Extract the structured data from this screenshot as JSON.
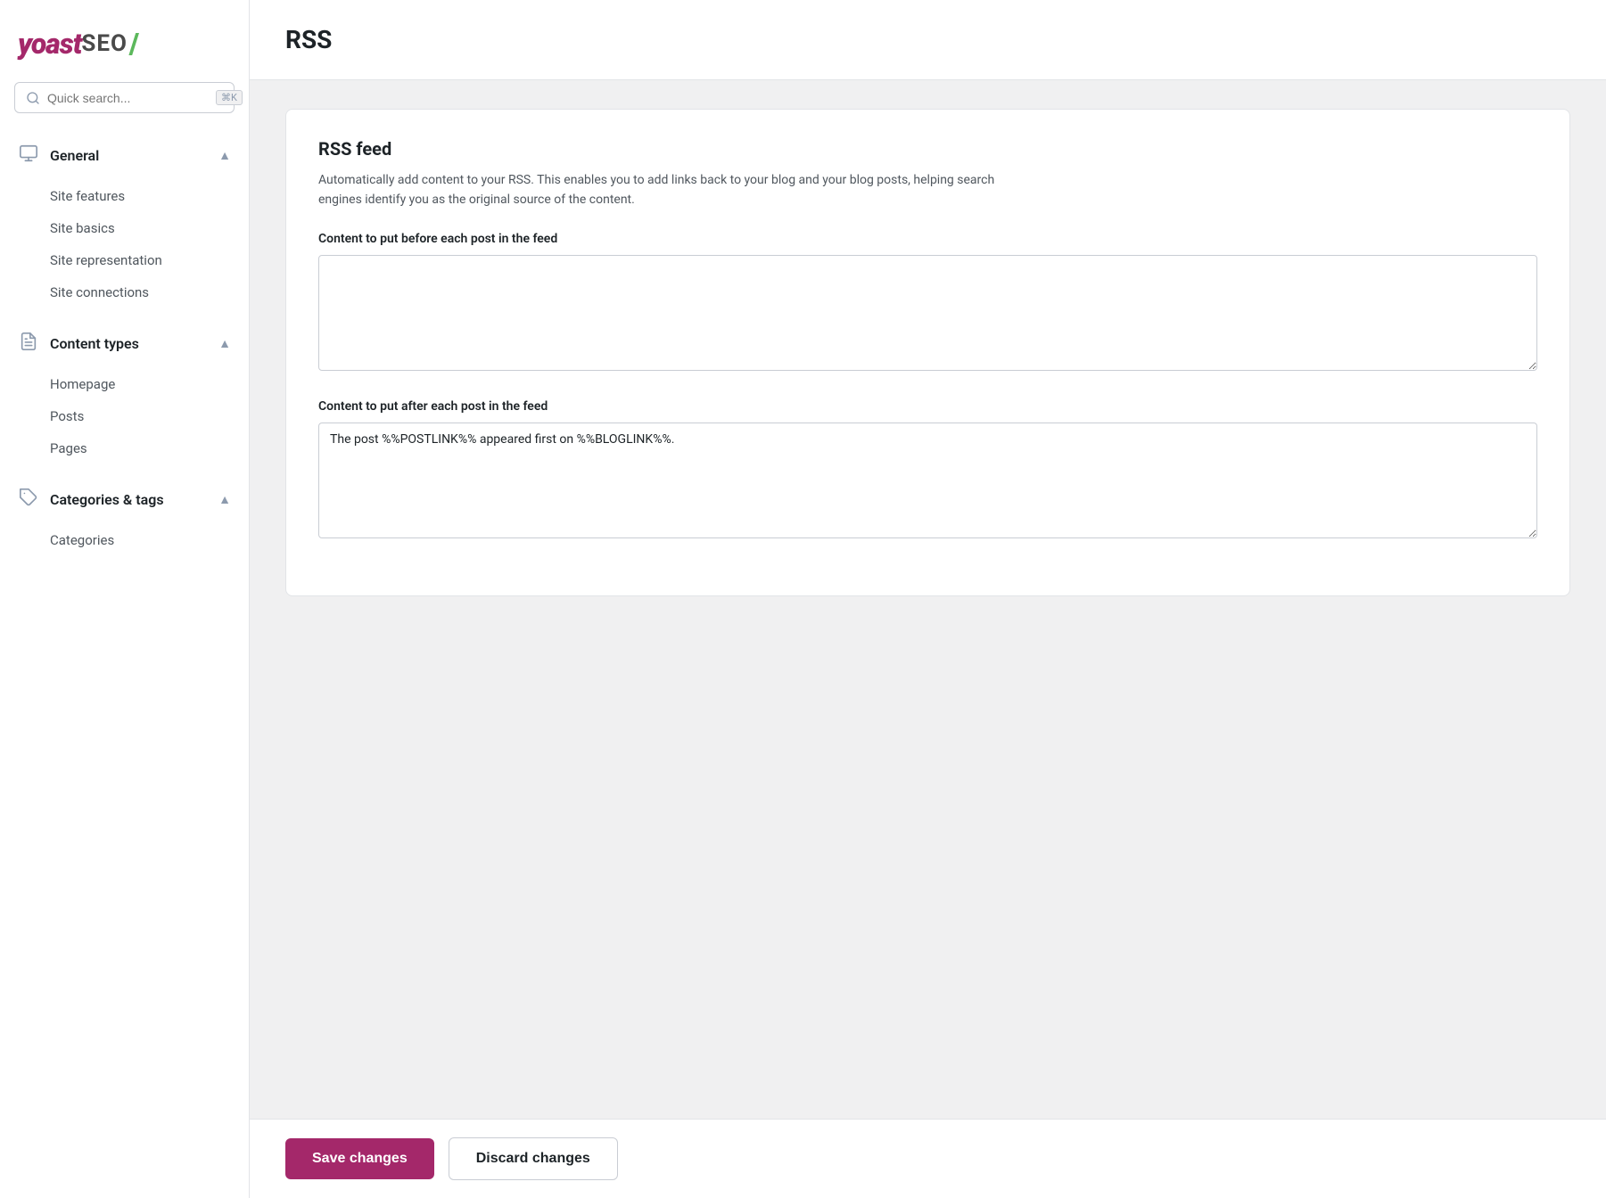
{
  "logo": {
    "yoast": "yoast",
    "seo": "SEO",
    "slash": "/"
  },
  "search": {
    "placeholder": "Quick search...",
    "shortcut": "⌘K"
  },
  "sidebar": {
    "sections": [
      {
        "id": "general",
        "title": "General",
        "icon": "monitor",
        "expanded": true,
        "items": [
          {
            "label": "Site features",
            "id": "site-features"
          },
          {
            "label": "Site basics",
            "id": "site-basics"
          },
          {
            "label": "Site representation",
            "id": "site-representation"
          },
          {
            "label": "Site connections",
            "id": "site-connections"
          }
        ]
      },
      {
        "id": "content-types",
        "title": "Content types",
        "icon": "document",
        "expanded": true,
        "items": [
          {
            "label": "Homepage",
            "id": "homepage"
          },
          {
            "label": "Posts",
            "id": "posts"
          },
          {
            "label": "Pages",
            "id": "pages"
          }
        ]
      },
      {
        "id": "categories-tags",
        "title": "Categories & tags",
        "icon": "tag",
        "expanded": true,
        "items": [
          {
            "label": "Categories",
            "id": "categories"
          }
        ]
      }
    ]
  },
  "page": {
    "title": "RSS",
    "card": {
      "section_title": "RSS feed",
      "description": "Automatically add content to your RSS. This enables you to add links back to your blog and your blog posts, helping search engines identify you as the original source of the content.",
      "field_before_label": "Content to put before each post in the feed",
      "field_before_value": "",
      "field_after_label": "Content to put after each post in the feed",
      "field_after_value": "The post %%POSTLINK%% appeared first on %%BLOGLINK%%."
    }
  },
  "footer": {
    "save_label": "Save changes",
    "discard_label": "Discard changes"
  }
}
